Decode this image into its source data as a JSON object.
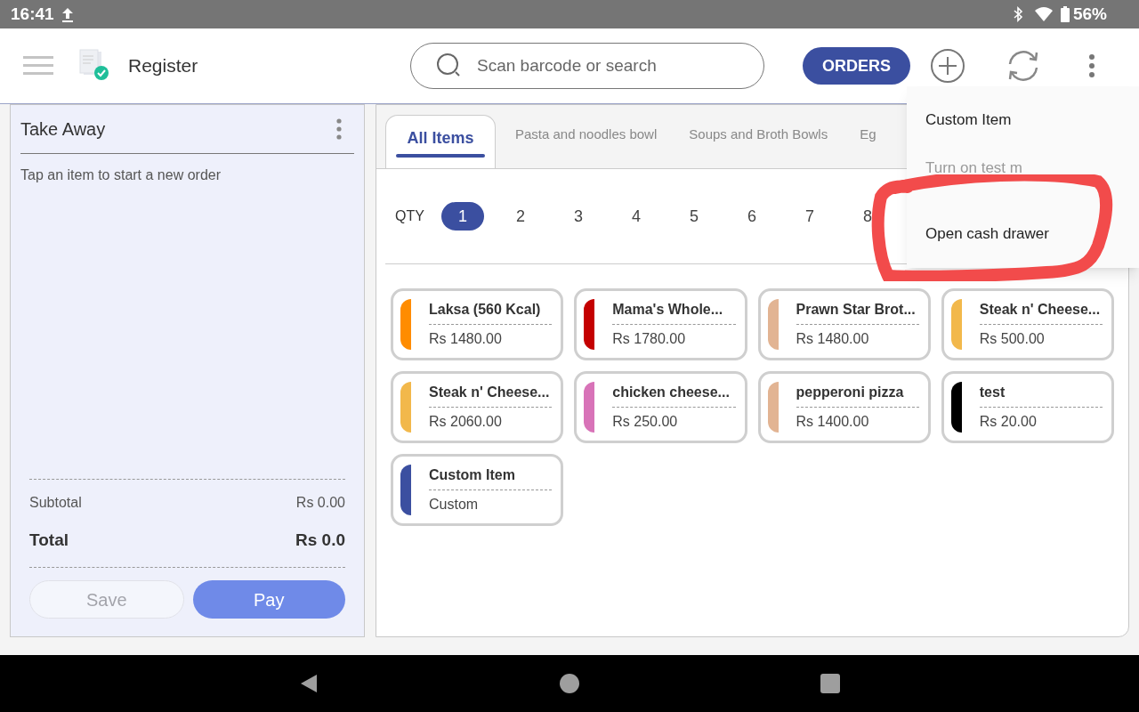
{
  "status_bar": {
    "time": "16:41",
    "battery": "56%"
  },
  "header": {
    "title": "Register",
    "search": {
      "placeholder": "Scan barcode or search"
    },
    "orders_button": "ORDERS"
  },
  "order_panel": {
    "title": "Take Away",
    "hint": "Tap an item to start a new order",
    "subtotal_label": "Subtotal",
    "subtotal": "Rs 0.00",
    "total_label": "Total",
    "total": "Rs 0.0",
    "buttons": [
      {
        "label": "Save",
        "kind": "secondary",
        "disabled": true
      },
      {
        "label": "Pay",
        "kind": "primary",
        "disabled": false
      }
    ]
  },
  "tabs": [
    {
      "label": "All Items",
      "selected": true
    },
    {
      "label": "Pasta and noodles bowl",
      "selected": false
    },
    {
      "label": "Soups and Broth Bowls",
      "selected": false
    },
    {
      "label": "Eg",
      "selected": false
    }
  ],
  "quantity": {
    "label": "QTY",
    "options": [
      {
        "label": "1",
        "selected": true
      },
      {
        "label": "2",
        "selected": false
      },
      {
        "label": "3",
        "selected": false
      },
      {
        "label": "4",
        "selected": false
      },
      {
        "label": "5",
        "selected": false
      },
      {
        "label": "6",
        "selected": false
      },
      {
        "label": "7",
        "selected": false
      },
      {
        "label": "8",
        "selected": false
      }
    ]
  },
  "items": [
    {
      "name": "Laksa (560 Kcal)",
      "price": "Rs 1480.00",
      "color": "#ff8c00"
    },
    {
      "name": "Mama's Whole...",
      "price": "Rs 1780.00",
      "color": "#c40000"
    },
    {
      "name": "Prawn Star Brot...",
      "price": "Rs 1480.00",
      "color": "#e2b493"
    },
    {
      "name": "Steak n' Cheese...",
      "price": "Rs 500.00",
      "color": "#f2b84b"
    },
    {
      "name": "Steak n' Cheese...",
      "price": "Rs 2060.00",
      "color": "#f2b84b"
    },
    {
      "name": "chicken cheese...",
      "price": "Rs 250.00",
      "color": "#d873b8"
    },
    {
      "name": "pepperoni pizza",
      "price": "Rs 1400.00",
      "color": "#e2b493"
    },
    {
      "name": "test",
      "price": "Rs 20.00",
      "color": "#000000"
    },
    {
      "name": "Custom Item",
      "price": "Custom",
      "color": "#3b4fa0"
    }
  ],
  "menu": [
    {
      "label": "Custom Item",
      "disabled": false
    },
    {
      "label": "Turn on test m",
      "disabled": true
    },
    {
      "label": "Open cash drawer",
      "disabled": false
    }
  ]
}
